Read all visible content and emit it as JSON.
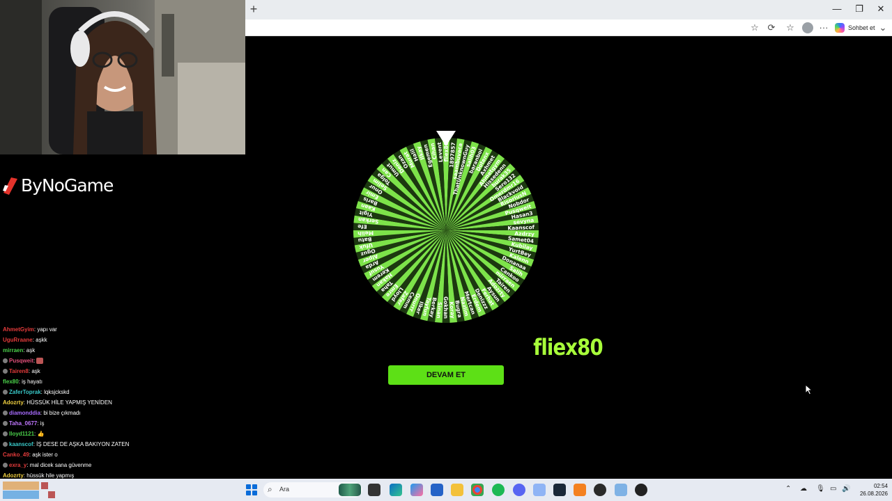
{
  "browser": {
    "new_tab": "+",
    "window_controls": {
      "minimize": "—",
      "maximize": "❐",
      "close": "✕"
    },
    "toolbar_icons": [
      "star-icon",
      "extensions-icon",
      "favorites-icon",
      "profile-icon",
      "more-icon"
    ],
    "copilot_label": "Sohbet et",
    "more_label": "···"
  },
  "wheel": {
    "colors": {
      "light": "#7de34a",
      "dark": "#1c3810"
    },
    "pointer_color": "#ffffff",
    "entries": [
      "fliex80",
      "1897857",
      "saambuvaca",
      "ThatUnknownGuy",
      "salih03",
      "baranboi",
      "Dotenx",
      "Axhmet",
      "Ahmetgym",
      "Hissedenn",
      "burak35",
      "Sero132",
      "Omerdmr16",
      "Blackvoid",
      "RisoriusN",
      "Nobdor",
      "Pusqweit",
      "Hasan3",
      "sevyna",
      "Kaanscof",
      "Azdrzy",
      "Samet04",
      "Kubilay",
      "YurtBey",
      "Kalenn",
      "Donanaa",
      "Salih",
      "Cankoo",
      "mirraen",
      "Tairen",
      "Adozrty",
      "Aysun",
      "Ferhat",
      "Denizzz",
      "Erdem",
      "Mertcan",
      "Nazlim",
      "Bugra",
      "Koray",
      "Gokhan",
      "Sinan",
      "Berkay",
      "Tayfun",
      "Ilker",
      "Onurrr",
      "Cemm",
      "Zafer",
      "Lloyd",
      "Emre",
      "Taha",
      "Hakan",
      "Kerem",
      "Yusuf",
      "Arda",
      "Alper",
      "Oguz",
      "Ufuk",
      "Batu",
      "Melih",
      "Efe",
      "Serkan",
      "Yigit",
      "Kaan",
      "Baris",
      "Emir",
      "Onur",
      "Selim",
      "Tolga",
      "Can",
      "Umut",
      "Deniz",
      "Ozan",
      "Murat",
      "Halil",
      "Ilkay",
      "Egemen",
      "Cihan",
      "Levent"
    ],
    "winner": "fliex80",
    "continue_label": "DEVAM ET"
  },
  "overlay": {
    "brand": "ByNoGame",
    "brand_icon": "slash-logo-icon"
  },
  "chat": [
    {
      "user": "AhmetGyim",
      "color": "#e33b3b",
      "badge": false,
      "text": " : yapı var"
    },
    {
      "user": "UguRraane",
      "color": "#e33b3b",
      "badge": false,
      "text": " : aşkk"
    },
    {
      "user": "mirraen",
      "color": "#4bd14b",
      "badge": false,
      "text": " : aşk"
    },
    {
      "user": "Pusqweit",
      "color": "#e0507a",
      "badge": true,
      "text": " : ",
      "emote": true
    },
    {
      "user": "Tairen8",
      "color": "#e33b3b",
      "badge": true,
      "text": " : aşk"
    },
    {
      "user": "flex80",
      "color": "#4bd14b",
      "badge": false,
      "text": " : iş hayatı"
    },
    {
      "user": "ZaferToprak",
      "color": "#39c9c9",
      "badge": true,
      "text": " : lqksjckskd"
    },
    {
      "user": "Adozrty",
      "color": "#f0d040",
      "badge": false,
      "text": " : HÜSSÜK HİLE YAPMIŞ YENİDEN"
    },
    {
      "user": "diamonddia",
      "color": "#a86cff",
      "badge": true,
      "text": " : bi bize çıkmadı"
    },
    {
      "user": "Taha_0677",
      "color": "#c077ff",
      "badge": true,
      "text": " : iş"
    },
    {
      "user": "lloyd1121",
      "color": "#4bd14b",
      "badge": true,
      "text": " : 👍"
    },
    {
      "user": "kaanscof",
      "color": "#39c9c9",
      "badge": true,
      "text": " : İŞ DESE DE AŞKA BAKIYON ZATEN"
    },
    {
      "user": "Canko_49",
      "color": "#e33b3b",
      "badge": false,
      "text": " : aşk ister o"
    },
    {
      "user": "exra_y",
      "color": "#e33b3b",
      "badge": true,
      "text": " : mal dicek sana güvenme"
    },
    {
      "user": "Adozrty",
      "color": "#f0d040",
      "badge": false,
      "text": " : hüssük hile yapmış"
    }
  ],
  "taskbar": {
    "search_placeholder": "Ara",
    "time": "02:54",
    "date": "26.08.2026"
  }
}
